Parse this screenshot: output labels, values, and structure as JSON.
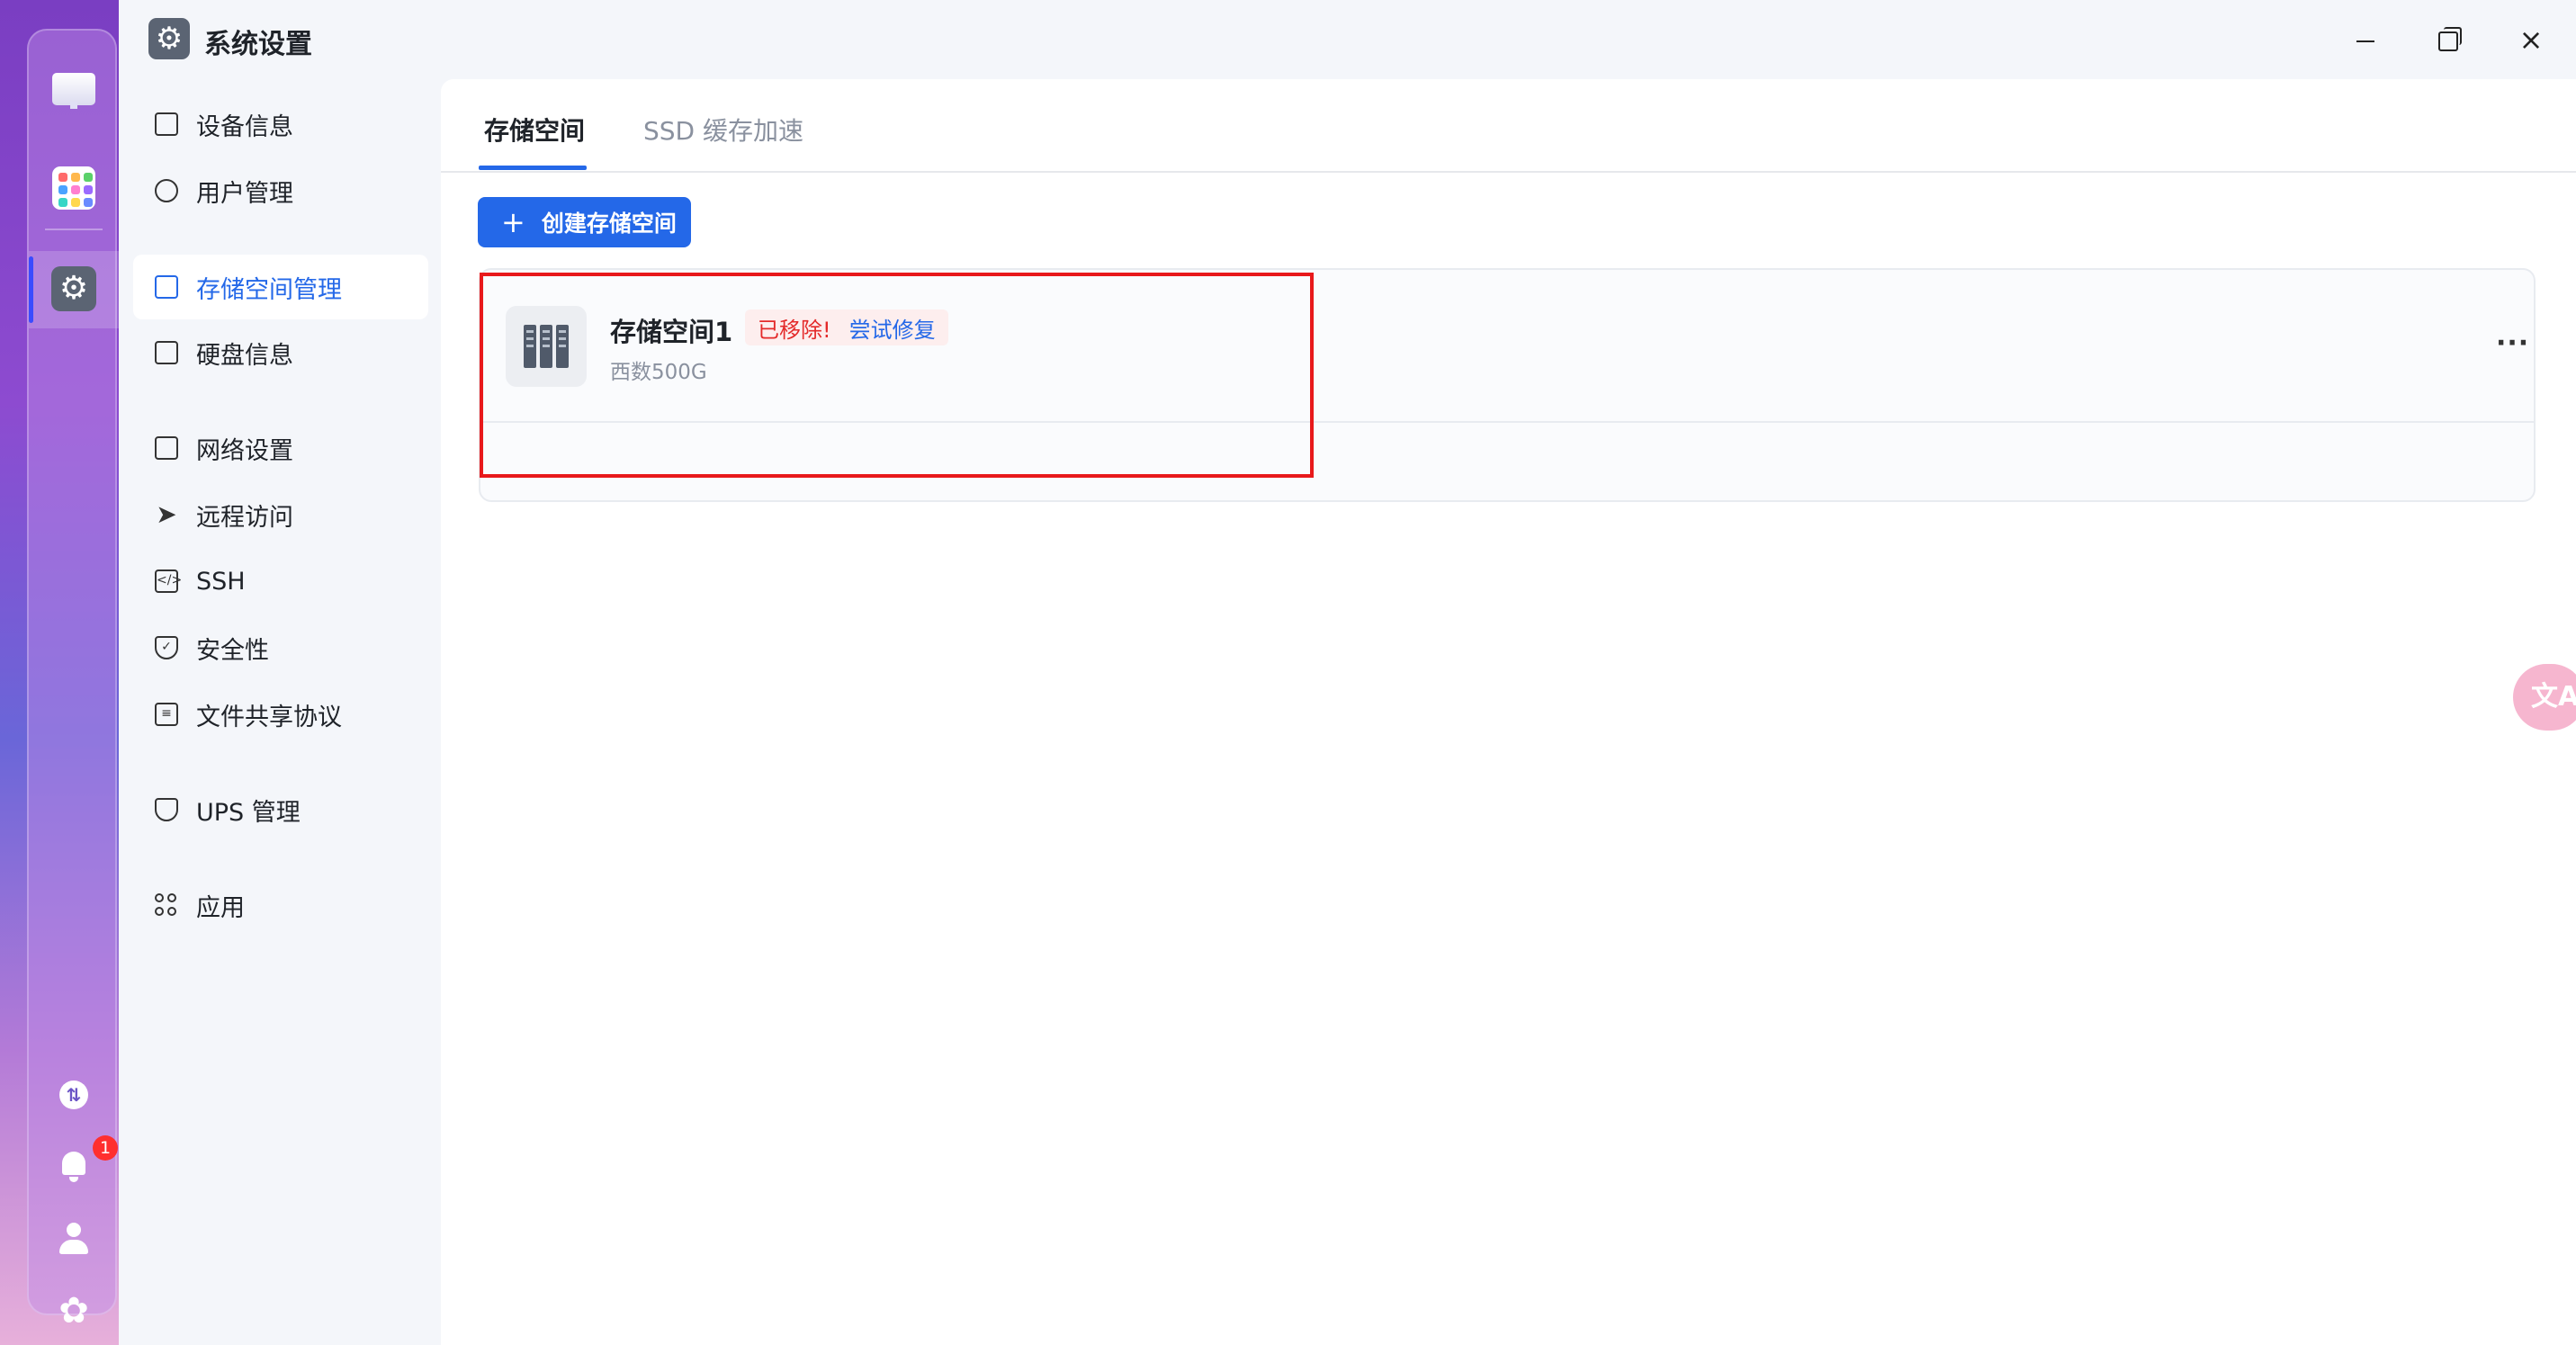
{
  "window": {
    "title": "系统设置",
    "controls": {
      "minimize": "minimize-icon",
      "maximize": "maximize-icon",
      "close": "×"
    }
  },
  "dock": {
    "badge_count": "1",
    "items": [
      "monitor-icon",
      "app-center-icon",
      "settings-icon",
      "transfer-icon",
      "bell-icon",
      "user-icon",
      "gear-icon"
    ]
  },
  "sidebar": {
    "items": [
      {
        "label": "设备信息",
        "icon": "device-icon"
      },
      {
        "label": "用户管理",
        "icon": "user-icon"
      },
      {
        "label": "存储空间管理",
        "icon": "storage-icon",
        "active": true
      },
      {
        "label": "硬盘信息",
        "icon": "disk-icon"
      },
      {
        "label": "网络设置",
        "icon": "network-icon"
      },
      {
        "label": "远程访问",
        "icon": "send-icon"
      },
      {
        "label": "SSH",
        "icon": "code-icon"
      },
      {
        "label": "安全性",
        "icon": "shield-icon"
      },
      {
        "label": "文件共享协议",
        "icon": "file-icon"
      },
      {
        "label": "UPS 管理",
        "icon": "ups-shield-icon"
      },
      {
        "label": "应用",
        "icon": "apps-grid-icon"
      }
    ]
  },
  "tabs": [
    {
      "label": "存储空间",
      "active": true
    },
    {
      "label": "SSD 缓存加速",
      "active": false
    }
  ],
  "toolbar": {
    "create_label": "创建存储空间",
    "create_icon": "+"
  },
  "pool": {
    "name": "存储空间1",
    "status": "已移除!",
    "repair_link": "尝试修复",
    "description": "西数500G",
    "more": "···"
  },
  "colors": {
    "accent": "#2468e8",
    "error": "#e42a2a",
    "highlight": "#e8191b"
  },
  "translate_fab": "文A"
}
